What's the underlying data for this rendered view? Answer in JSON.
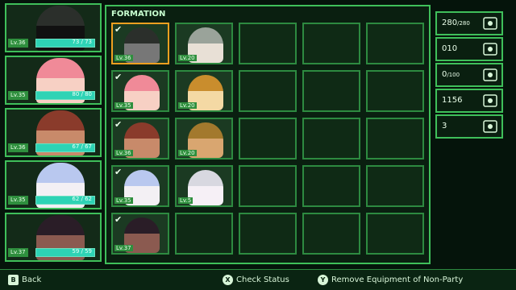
{
  "party": [
    {
      "level": "Lv.36",
      "hp": "73 / 73",
      "hp_fraction": 1.0,
      "palette": [
        "#2b2f2b",
        "#111"
      ]
    },
    {
      "level": "Lv.35",
      "hp": "80 / 80",
      "hp_fraction": 1.0,
      "palette": [
        "#f08a98",
        "#f7d0c4"
      ]
    },
    {
      "level": "Lv.36",
      "hp": "67 / 67",
      "hp_fraction": 1.0,
      "palette": [
        "#8a3b2b",
        "#c88a6a"
      ]
    },
    {
      "level": "Lv.35",
      "hp": "62 / 62",
      "hp_fraction": 1.0,
      "palette": [
        "#b9c8ef",
        "#f3f0f4"
      ]
    },
    {
      "level": "Lv.37",
      "hp": "59 / 59",
      "hp_fraction": 1.0,
      "palette": [
        "#2a1d27",
        "#8b5a50"
      ]
    }
  ],
  "formation": {
    "title": "FORMATION",
    "rows": [
      [
        {
          "filled": true,
          "checked": true,
          "selected": true,
          "level": "Lv.36",
          "colors": [
            "#2b2f2b",
            "#777"
          ]
        },
        {
          "filled": true,
          "checked": false,
          "level": "Lv.20",
          "colors": [
            "#9aa39a",
            "#e8e0d6"
          ]
        },
        {
          "filled": false
        },
        {
          "filled": false
        },
        {
          "filled": false
        }
      ],
      [
        {
          "filled": true,
          "checked": true,
          "level": "Lv.35",
          "colors": [
            "#f08a98",
            "#f7d0c4"
          ]
        },
        {
          "filled": true,
          "checked": false,
          "level": "Lv.20",
          "colors": [
            "#c98d2d",
            "#f4d9a4"
          ]
        },
        {
          "filled": false
        },
        {
          "filled": false
        },
        {
          "filled": false
        }
      ],
      [
        {
          "filled": true,
          "checked": true,
          "level": "Lv.36",
          "colors": [
            "#8a3b2b",
            "#c88a6a"
          ]
        },
        {
          "filled": true,
          "checked": false,
          "level": "Lv.20",
          "colors": [
            "#a3792d",
            "#d9a670"
          ]
        },
        {
          "filled": false
        },
        {
          "filled": false
        },
        {
          "filled": false
        }
      ],
      [
        {
          "filled": true,
          "checked": true,
          "level": "Lv.35",
          "colors": [
            "#b9c8ef",
            "#f3f0f4"
          ]
        },
        {
          "filled": true,
          "checked": false,
          "level": "Lv.5",
          "colors": [
            "#d8d8e0",
            "#f6f0f6"
          ]
        },
        {
          "filled": false
        },
        {
          "filled": false
        },
        {
          "filled": false
        }
      ],
      [
        {
          "filled": true,
          "checked": true,
          "level": "Lv.37",
          "colors": [
            "#2a1d27",
            "#8b5a50"
          ]
        },
        {
          "filled": false
        },
        {
          "filled": false
        },
        {
          "filled": false
        },
        {
          "filled": false
        }
      ]
    ]
  },
  "stats": [
    {
      "value": "280",
      "max": "/280",
      "icon": "sparkle-card-icon"
    },
    {
      "value": "010",
      "icon": "calendar-icon"
    },
    {
      "value": "0",
      "max": "/100",
      "icon": "fish-icon"
    },
    {
      "value": "1156",
      "icon": "gear-icon"
    },
    {
      "value": "3",
      "icon": "key-icon"
    }
  ],
  "bottom": {
    "back": "Back",
    "check_status": "Check Status",
    "remove_equipment": "Remove Equipment of Non-Party",
    "back_glyph": "B",
    "x_glyph": "X",
    "y_glyph": "Y"
  }
}
